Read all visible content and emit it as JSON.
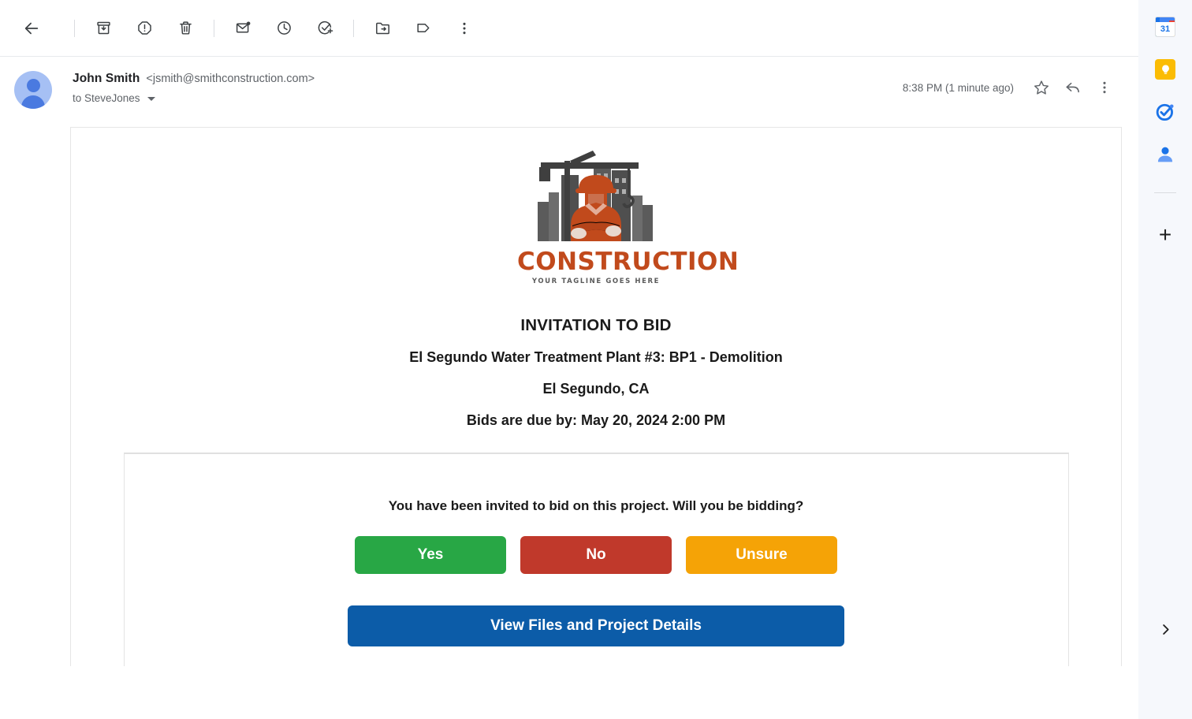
{
  "toolbar": {
    "back": "Back",
    "items": [
      {
        "name": "archive-button",
        "label": "Archive"
      },
      {
        "name": "report-spam-button",
        "label": "Report spam"
      },
      {
        "name": "delete-button",
        "label": "Delete"
      },
      {
        "name": "mark-unread-button",
        "label": "Mark as unread"
      },
      {
        "name": "snooze-button",
        "label": "Snooze"
      },
      {
        "name": "add-to-tasks-button",
        "label": "Add to tasks"
      },
      {
        "name": "move-to-button",
        "label": "Move to"
      },
      {
        "name": "labels-button",
        "label": "Labels"
      },
      {
        "name": "more-options-button",
        "label": "More"
      }
    ]
  },
  "message": {
    "sender_name": "John Smith",
    "sender_email": "<jsmith@smithconstruction.com>",
    "recipient": "to SteveJones",
    "timestamp": "8:38 PM (1 minute ago)",
    "star_label": "Star",
    "reply_label": "Reply",
    "more_label": "More"
  },
  "email": {
    "logo": {
      "title": "CONSTRUCTION",
      "tagline": "YOUR TAGLINE GOES HERE",
      "brand_color": "#c14a1c",
      "building_color": "#555555"
    },
    "heading": "INVITATION TO BID",
    "project": "El Segundo Water Treatment Plant #3: BP1 - Demolition",
    "location": "El Segundo, CA",
    "due": "Bids are due by: May 20, 2024 2:00 PM",
    "prompt": "You have been invited to bid on this project. Will you be bidding?",
    "responses": [
      {
        "label": "Yes",
        "color": "#28a745",
        "name": "respond-yes-button"
      },
      {
        "label": "No",
        "color": "#c0392b",
        "name": "respond-no-button"
      },
      {
        "label": "Unsure",
        "color": "#f5a306",
        "name": "respond-unsure-button"
      }
    ],
    "cta": {
      "label": "View Files and Project Details",
      "color": "#0c5ca8"
    }
  },
  "side_panel": {
    "items": [
      {
        "name": "google-calendar-icon",
        "label": "Calendar",
        "day": "31"
      },
      {
        "name": "google-keep-icon",
        "label": "Keep"
      },
      {
        "name": "google-tasks-icon",
        "label": "Tasks"
      },
      {
        "name": "google-contacts-icon",
        "label": "Contacts"
      }
    ],
    "add_label": "+",
    "expand_label": "Show side panel"
  }
}
